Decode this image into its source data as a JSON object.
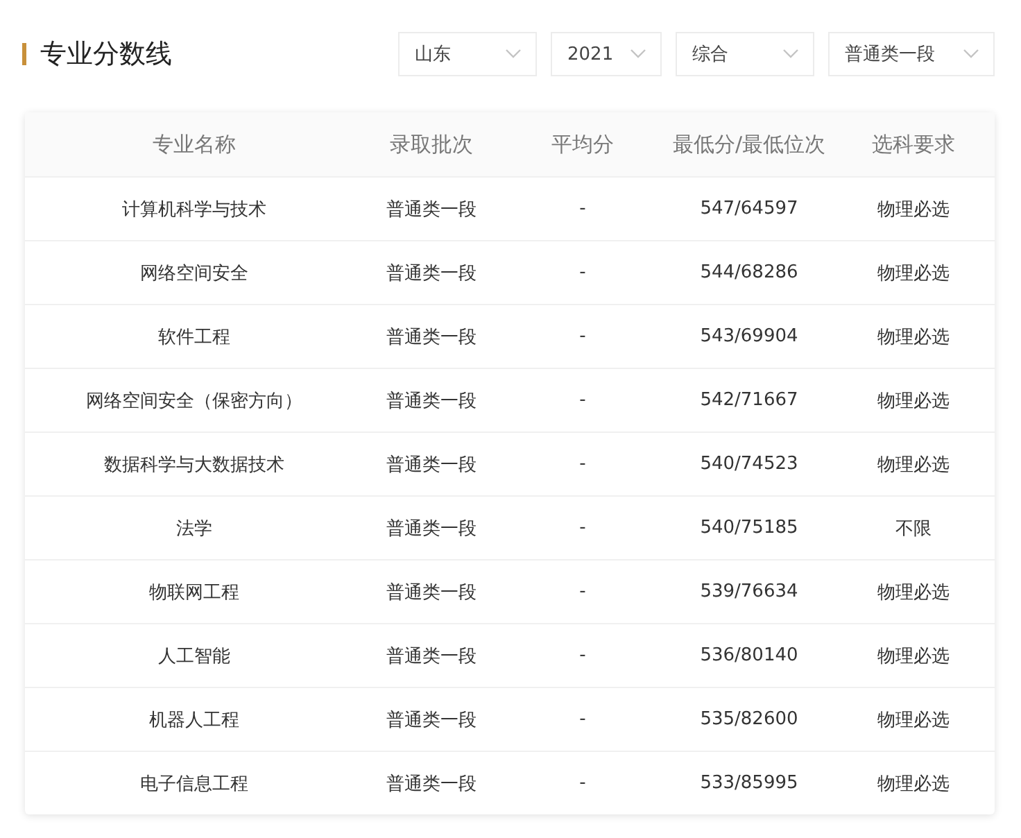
{
  "title": "专业分数线",
  "filters": [
    {
      "value": "山东"
    },
    {
      "value": "2021"
    },
    {
      "value": "综合"
    },
    {
      "value": "普通类一段"
    }
  ],
  "table": {
    "columns": [
      "专业名称",
      "录取批次",
      "平均分",
      "最低分/最低位次",
      "选科要求"
    ],
    "rows": [
      [
        "计算机科学与技术",
        "普通类一段",
        "-",
        "547/64597",
        "物理必选"
      ],
      [
        "网络空间安全",
        "普通类一段",
        "-",
        "544/68286",
        "物理必选"
      ],
      [
        "软件工程",
        "普通类一段",
        "-",
        "543/69904",
        "物理必选"
      ],
      [
        "网络空间安全（保密方向）",
        "普通类一段",
        "-",
        "542/71667",
        "物理必选"
      ],
      [
        "数据科学与大数据技术",
        "普通类一段",
        "-",
        "540/74523",
        "物理必选"
      ],
      [
        "法学",
        "普通类一段",
        "-",
        "540/75185",
        "不限"
      ],
      [
        "物联网工程",
        "普通类一段",
        "-",
        "539/76634",
        "物理必选"
      ],
      [
        "人工智能",
        "普通类一段",
        "-",
        "536/80140",
        "物理必选"
      ],
      [
        "机器人工程",
        "普通类一段",
        "-",
        "535/82600",
        "物理必选"
      ],
      [
        "电子信息工程",
        "普通类一段",
        "-",
        "533/85995",
        "物理必选"
      ]
    ]
  }
}
